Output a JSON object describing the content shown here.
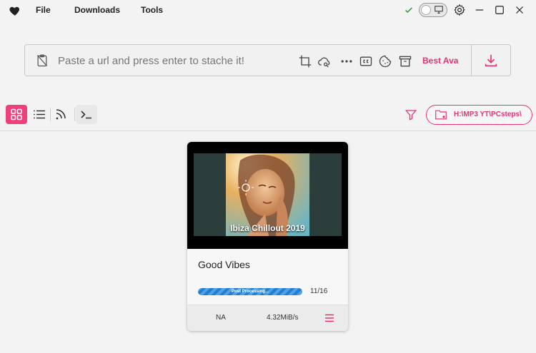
{
  "menu": {
    "file": "File",
    "downloads": "Downloads",
    "tools": "Tools"
  },
  "urlbar": {
    "placeholder": "Paste a url and press enter to stache it!",
    "quality": "Best Available"
  },
  "toolbar": {
    "download_path": "H:\\MP3 YT\\PCsteps\\"
  },
  "card": {
    "title": "Good Vibes",
    "thumbnail_caption": "Ibiza Chillout 2019",
    "progress_text": "Post Processing...",
    "progress_fraction": 1.0,
    "count": "11/16",
    "eta": "NA",
    "speed": "4.32MiB/s"
  },
  "colors": {
    "accent": "#e8336d",
    "progress": "#1e7fd6",
    "check": "#2e9e3e"
  },
  "icons": [
    "heart-icon",
    "check-icon",
    "monitor-icon",
    "gear-icon",
    "minimize-icon",
    "maximize-icon",
    "close-icon",
    "clipboard-icon",
    "crop-icon",
    "cloud-search-icon",
    "more-icon",
    "cc-icon",
    "cookie-icon",
    "archive-icon",
    "download-icon",
    "grid-icon",
    "list-icon",
    "rss-icon",
    "terminal-icon",
    "filter-icon",
    "folder-icon",
    "hamburger-icon"
  ]
}
